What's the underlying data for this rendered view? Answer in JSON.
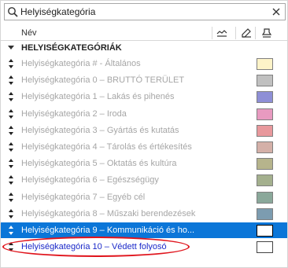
{
  "search": {
    "value": "Helyiségkategória"
  },
  "header": {
    "name_col": "Név"
  },
  "group": {
    "label": "HELYISÉGKATEGÓRIÁK"
  },
  "rows": [
    {
      "label": "Helyiségkategória # - Általános",
      "color": "#fdf3c8"
    },
    {
      "label": "Helyiségkategória 0 – BRUTTÓ TERÜLET",
      "color": "#c0c0c0"
    },
    {
      "label": "Helyiségkategória 1 – Lakás és pihenés",
      "color": "#8e8fd6"
    },
    {
      "label": "Helyiségkategória 2 – Iroda",
      "color": "#e89ac0"
    },
    {
      "label": "Helyiségkategória 3 – Gyártás és kutatás",
      "color": "#e8989c"
    },
    {
      "label": "Helyiségkategória 4 – Tárolás és értékesítés",
      "color": "#d4b0a8"
    },
    {
      "label": "Helyiségkategória 5 – Oktatás és kultúra",
      "color": "#b6b48c"
    },
    {
      "label": "Helyiségkategória 6 – Egészségügy",
      "color": "#a4b08e"
    },
    {
      "label": "Helyiségkategória 7 – Egyéb cél",
      "color": "#8aa89a"
    },
    {
      "label": "Helyiségkategória 8 – Műszaki berendezések",
      "color": "#7c9cb0"
    },
    {
      "label": "Helyiségkategória 9 – Kommunikáció és ho...",
      "color": "#ffffff"
    },
    {
      "label": "Helyiségkategória 10 – Védett folyosó",
      "color": "#ffffff"
    }
  ],
  "colors": {
    "selection": "#0b76d8",
    "highlight_text": "#1b29c9",
    "annotation": "#e0141c"
  }
}
